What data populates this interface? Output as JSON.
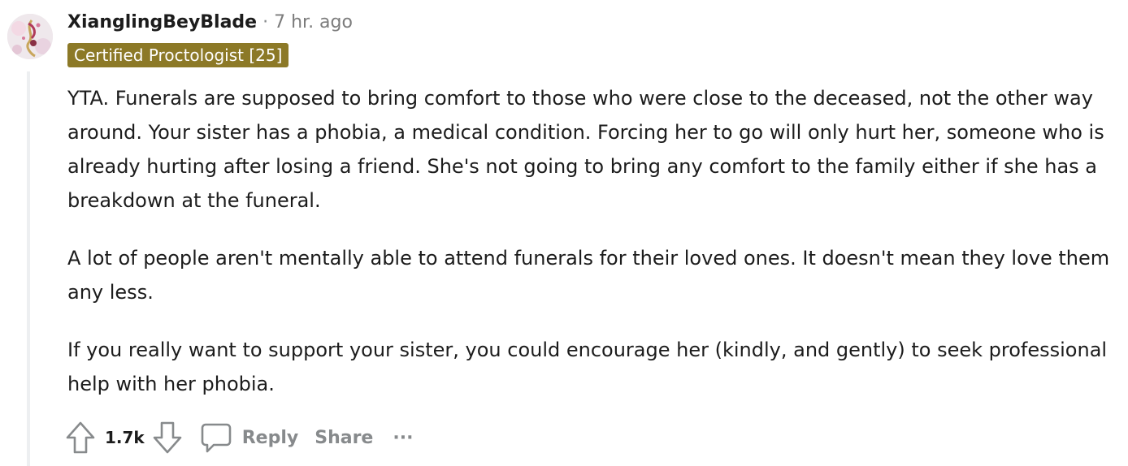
{
  "comment": {
    "author": "XianglingBeyBlade",
    "separator": "·",
    "timestamp": "7 hr. ago",
    "flair": "Certified Proctologist [25]",
    "flair_color": "#8c7927",
    "avatar_icon": "user-avatar",
    "paragraphs": [
      "YTA. Funerals are supposed to bring comfort to those who were close to the deceased, not the other way around. Your sister has a phobia, a medical condition. Forcing her to go will only hurt her, someone who is already hurting after losing a friend. She's not going to bring any comfort to the family either if she has a breakdown at the funeral.",
      "A lot of people aren't mentally able to attend funerals for their loved ones. It doesn't mean they love them any less.",
      "If you really want to support your sister, you could encourage her (kindly, and gently) to seek professional help with her phobia."
    ]
  },
  "actions": {
    "upvote_icon": "upvote-arrow-icon",
    "score": "1.7k",
    "downvote_icon": "downvote-arrow-icon",
    "reply_icon": "speech-bubble-icon",
    "reply_label": "Reply",
    "share_label": "Share",
    "more_icon": "ellipsis-icon",
    "more_label": "···"
  },
  "colors": {
    "text": "#1c1c1c",
    "muted": "#878a8c",
    "thread_line": "#edeff1"
  }
}
